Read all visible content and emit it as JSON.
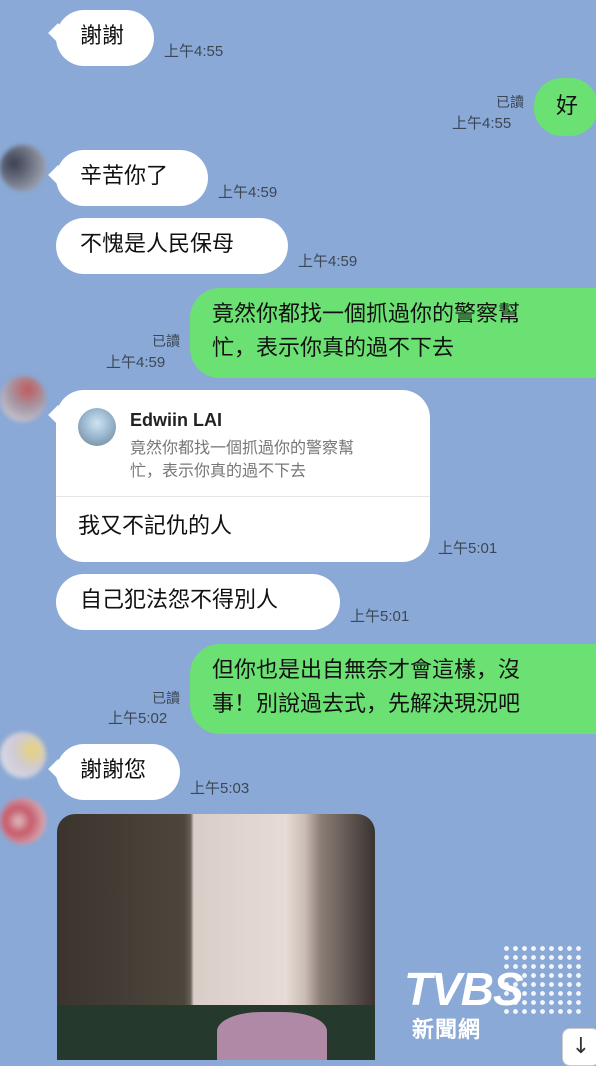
{
  "messages": [
    {
      "text": "謝謝",
      "time": "上午4:55"
    },
    {
      "text": "好",
      "time": "上午4:55",
      "read": "已讀"
    },
    {
      "text": "辛苦你了",
      "time": "上午4:59"
    },
    {
      "text": "不愧是人民保母",
      "time": "上午4:59"
    },
    {
      "text_line1": "竟然你都找一個抓過你的警察幫",
      "text_line2": "忙，表示你真的過不下去",
      "time": "上午4:59",
      "read": "已讀"
    },
    {
      "reply_to_name": "Edwiin LAI",
      "quote_line1": "竟然你都找一個抓過你的警察幫",
      "quote_line2": "忙，表示你真的過不下去",
      "text": "我又不記仇的人",
      "time": "上午5:01"
    },
    {
      "text": "自己犯法怨不得別人",
      "time": "上午5:01"
    },
    {
      "text_line1": "但你也是出自無奈才會這樣，沒",
      "text_line2": "事！別說過去式，先解決現況吧",
      "time": "上午5:02",
      "read": "已讀"
    },
    {
      "text": "謝謝您",
      "time": "上午5:03"
    }
  ],
  "watermark": {
    "brand": "TVBS",
    "sub": "新聞網"
  },
  "icons": {
    "scroll_down": "↓"
  },
  "colors": {
    "background": "#8aa9d6",
    "incoming": "#ffffff",
    "outgoing": "#6be173"
  }
}
